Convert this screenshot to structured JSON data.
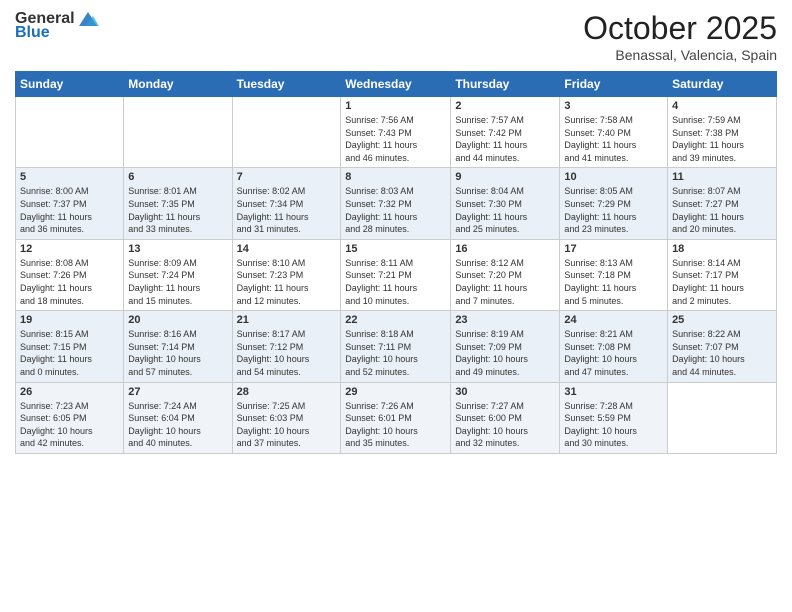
{
  "header": {
    "logo_general": "General",
    "logo_blue": "Blue",
    "month": "October 2025",
    "location": "Benassal, Valencia, Spain"
  },
  "days_of_week": [
    "Sunday",
    "Monday",
    "Tuesday",
    "Wednesday",
    "Thursday",
    "Friday",
    "Saturday"
  ],
  "weeks": [
    [
      {
        "day": "",
        "info": ""
      },
      {
        "day": "",
        "info": ""
      },
      {
        "day": "",
        "info": ""
      },
      {
        "day": "1",
        "info": "Sunrise: 7:56 AM\nSunset: 7:43 PM\nDaylight: 11 hours\nand 46 minutes."
      },
      {
        "day": "2",
        "info": "Sunrise: 7:57 AM\nSunset: 7:42 PM\nDaylight: 11 hours\nand 44 minutes."
      },
      {
        "day": "3",
        "info": "Sunrise: 7:58 AM\nSunset: 7:40 PM\nDaylight: 11 hours\nand 41 minutes."
      },
      {
        "day": "4",
        "info": "Sunrise: 7:59 AM\nSunset: 7:38 PM\nDaylight: 11 hours\nand 39 minutes."
      }
    ],
    [
      {
        "day": "5",
        "info": "Sunrise: 8:00 AM\nSunset: 7:37 PM\nDaylight: 11 hours\nand 36 minutes."
      },
      {
        "day": "6",
        "info": "Sunrise: 8:01 AM\nSunset: 7:35 PM\nDaylight: 11 hours\nand 33 minutes."
      },
      {
        "day": "7",
        "info": "Sunrise: 8:02 AM\nSunset: 7:34 PM\nDaylight: 11 hours\nand 31 minutes."
      },
      {
        "day": "8",
        "info": "Sunrise: 8:03 AM\nSunset: 7:32 PM\nDaylight: 11 hours\nand 28 minutes."
      },
      {
        "day": "9",
        "info": "Sunrise: 8:04 AM\nSunset: 7:30 PM\nDaylight: 11 hours\nand 25 minutes."
      },
      {
        "day": "10",
        "info": "Sunrise: 8:05 AM\nSunset: 7:29 PM\nDaylight: 11 hours\nand 23 minutes."
      },
      {
        "day": "11",
        "info": "Sunrise: 8:07 AM\nSunset: 7:27 PM\nDaylight: 11 hours\nand 20 minutes."
      }
    ],
    [
      {
        "day": "12",
        "info": "Sunrise: 8:08 AM\nSunset: 7:26 PM\nDaylight: 11 hours\nand 18 minutes."
      },
      {
        "day": "13",
        "info": "Sunrise: 8:09 AM\nSunset: 7:24 PM\nDaylight: 11 hours\nand 15 minutes."
      },
      {
        "day": "14",
        "info": "Sunrise: 8:10 AM\nSunset: 7:23 PM\nDaylight: 11 hours\nand 12 minutes."
      },
      {
        "day": "15",
        "info": "Sunrise: 8:11 AM\nSunset: 7:21 PM\nDaylight: 11 hours\nand 10 minutes."
      },
      {
        "day": "16",
        "info": "Sunrise: 8:12 AM\nSunset: 7:20 PM\nDaylight: 11 hours\nand 7 minutes."
      },
      {
        "day": "17",
        "info": "Sunrise: 8:13 AM\nSunset: 7:18 PM\nDaylight: 11 hours\nand 5 minutes."
      },
      {
        "day": "18",
        "info": "Sunrise: 8:14 AM\nSunset: 7:17 PM\nDaylight: 11 hours\nand 2 minutes."
      }
    ],
    [
      {
        "day": "19",
        "info": "Sunrise: 8:15 AM\nSunset: 7:15 PM\nDaylight: 11 hours\nand 0 minutes."
      },
      {
        "day": "20",
        "info": "Sunrise: 8:16 AM\nSunset: 7:14 PM\nDaylight: 10 hours\nand 57 minutes."
      },
      {
        "day": "21",
        "info": "Sunrise: 8:17 AM\nSunset: 7:12 PM\nDaylight: 10 hours\nand 54 minutes."
      },
      {
        "day": "22",
        "info": "Sunrise: 8:18 AM\nSunset: 7:11 PM\nDaylight: 10 hours\nand 52 minutes."
      },
      {
        "day": "23",
        "info": "Sunrise: 8:19 AM\nSunset: 7:09 PM\nDaylight: 10 hours\nand 49 minutes."
      },
      {
        "day": "24",
        "info": "Sunrise: 8:21 AM\nSunset: 7:08 PM\nDaylight: 10 hours\nand 47 minutes."
      },
      {
        "day": "25",
        "info": "Sunrise: 8:22 AM\nSunset: 7:07 PM\nDaylight: 10 hours\nand 44 minutes."
      }
    ],
    [
      {
        "day": "26",
        "info": "Sunrise: 7:23 AM\nSunset: 6:05 PM\nDaylight: 10 hours\nand 42 minutes."
      },
      {
        "day": "27",
        "info": "Sunrise: 7:24 AM\nSunset: 6:04 PM\nDaylight: 10 hours\nand 40 minutes."
      },
      {
        "day": "28",
        "info": "Sunrise: 7:25 AM\nSunset: 6:03 PM\nDaylight: 10 hours\nand 37 minutes."
      },
      {
        "day": "29",
        "info": "Sunrise: 7:26 AM\nSunset: 6:01 PM\nDaylight: 10 hours\nand 35 minutes."
      },
      {
        "day": "30",
        "info": "Sunrise: 7:27 AM\nSunset: 6:00 PM\nDaylight: 10 hours\nand 32 minutes."
      },
      {
        "day": "31",
        "info": "Sunrise: 7:28 AM\nSunset: 5:59 PM\nDaylight: 10 hours\nand 30 minutes."
      },
      {
        "day": "",
        "info": ""
      }
    ]
  ]
}
